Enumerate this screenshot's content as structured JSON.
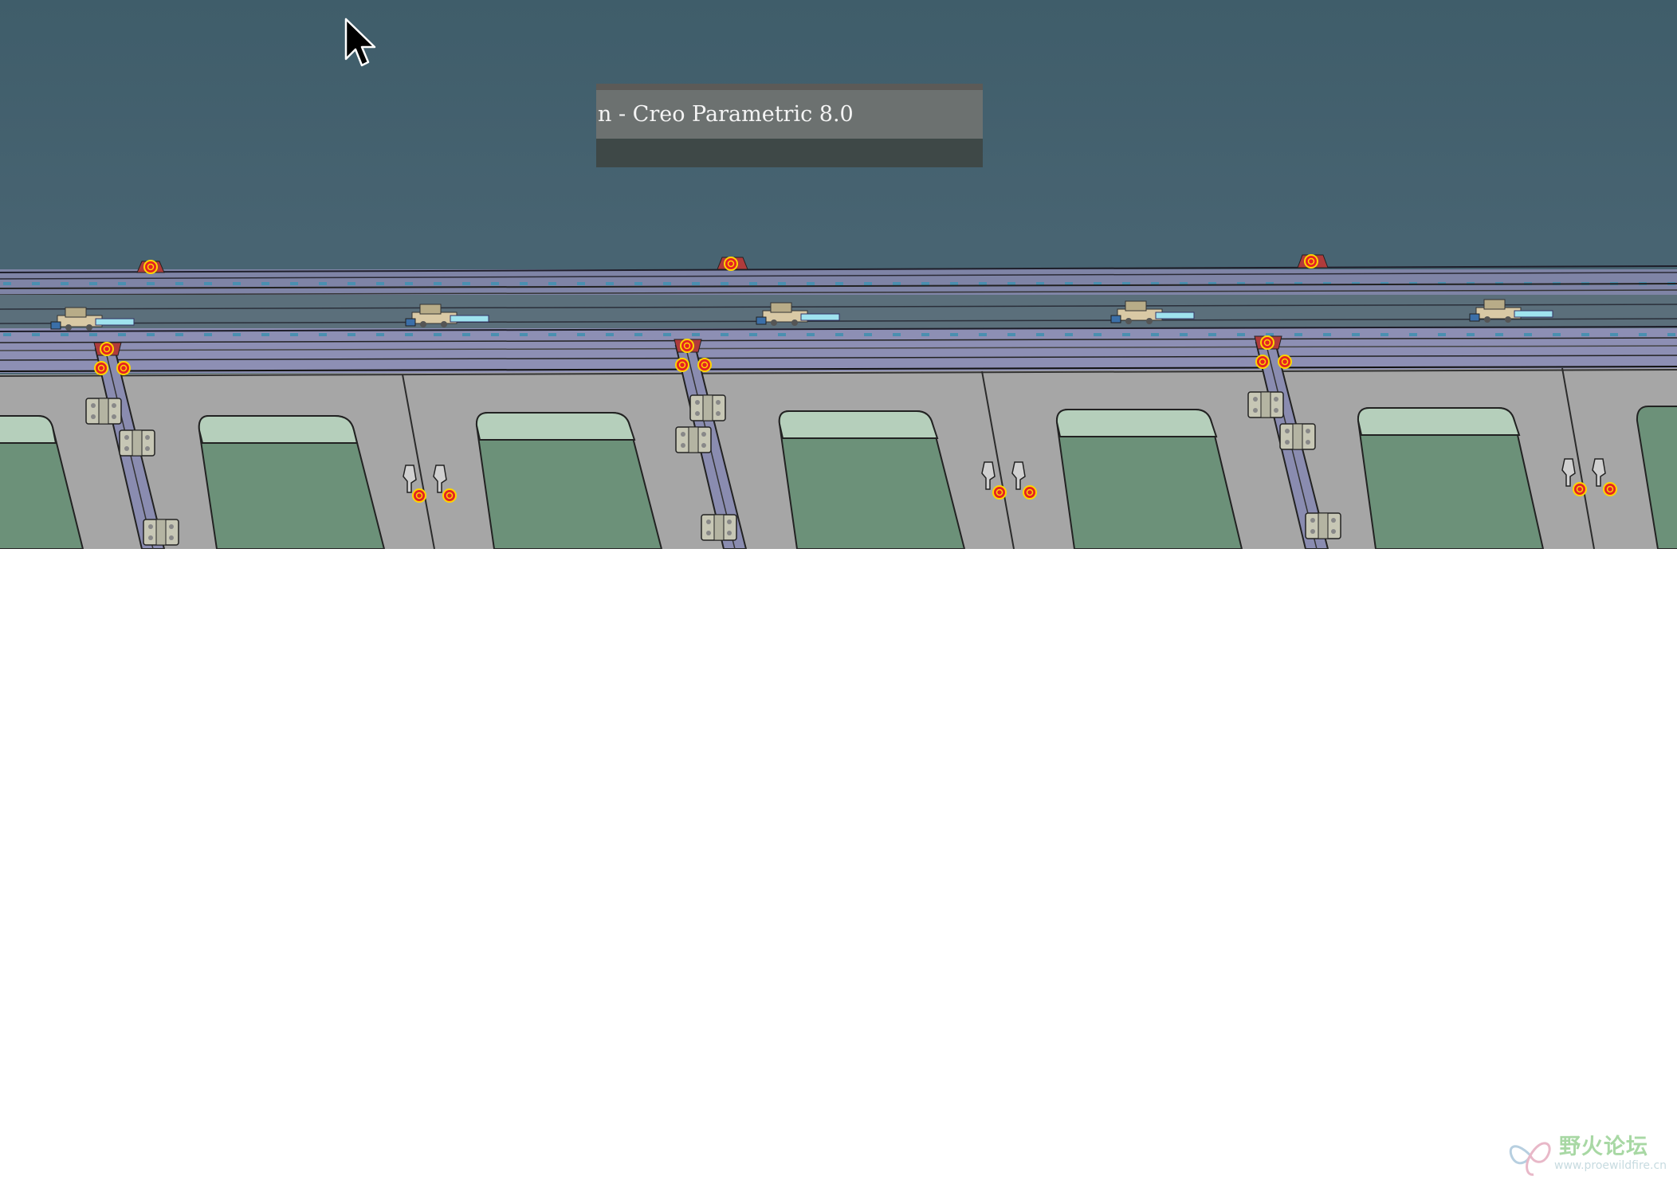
{
  "window": {
    "title_fragment": "n - Creo Parametric 8.0"
  },
  "viewport": {
    "background_color": "#486472",
    "model_colors": {
      "panel": "#a6a6a6",
      "glass": "#6c9179",
      "glass_rim": "#b5cfbb",
      "rail": "#8d8fb4",
      "hinge": "#c7c7b5",
      "marker_fill": "#e42222",
      "marker_ring": "#ffd400"
    },
    "bay_count": 6,
    "datum_marker_count": 20
  },
  "watermark": {
    "text_cn": "野火论坛",
    "url": "www.proewildfire.cn"
  },
  "icons": [
    "mouse-pointer-icon",
    "datum-marker-icon",
    "watermark-logo-icon"
  ]
}
